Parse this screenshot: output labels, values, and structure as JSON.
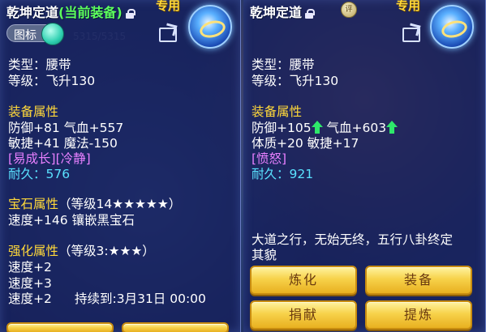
{
  "left": {
    "title": "乾坤定道",
    "title_suffix": "(当前装备)",
    "exclusive": "专用",
    "toggle_label": "图标",
    "type_line": "类型：腰带",
    "level_line": "等级：飞升130",
    "attr_header": "装备属性",
    "attr_line1": "防御+81  气血+557",
    "attr_line2": "敏捷+41  魔法-150",
    "special_line": "[易成长][冷静]",
    "durability": "耐久：576",
    "gem_header": "宝石属性",
    "gem_level": "（等级14★★★★★）",
    "gem_line": "速度+146 镶嵌黑宝石",
    "enhance_header": "强化属性",
    "enhance_level": "（等级3:★★★）",
    "enhance_line1": "速度+2",
    "enhance_line2": "速度+3",
    "enhance_line3": "速度+2",
    "enhance_duration": "持续到:3月31日 00:00"
  },
  "right": {
    "title": "乾坤定道",
    "exclusive": "专用",
    "badge_text": "评",
    "type_line": "类型：腰带",
    "level_line": "等级：飞升130",
    "attr_header": "装备属性",
    "attr_line1": "防御+105",
    "attr_line1b": "气血+603",
    "attr_line2": "体质+20 敏捷+17",
    "special_line": "[愤怒]",
    "durability": "耐久：921",
    "desc_line1": "大道之行，无始无终，五行八卦终定",
    "desc_line2": "其貌",
    "buttons": {
      "refine": "炼化",
      "equip": "装备",
      "donate": "捐献",
      "extract": "提炼"
    }
  },
  "colors": {
    "header_yellow": "#ffd83a",
    "special_purple": "#e880ff",
    "durability_cyan": "#5ae2ff",
    "current_green": "#5cff5c",
    "button_gold": "#f7d24a"
  }
}
